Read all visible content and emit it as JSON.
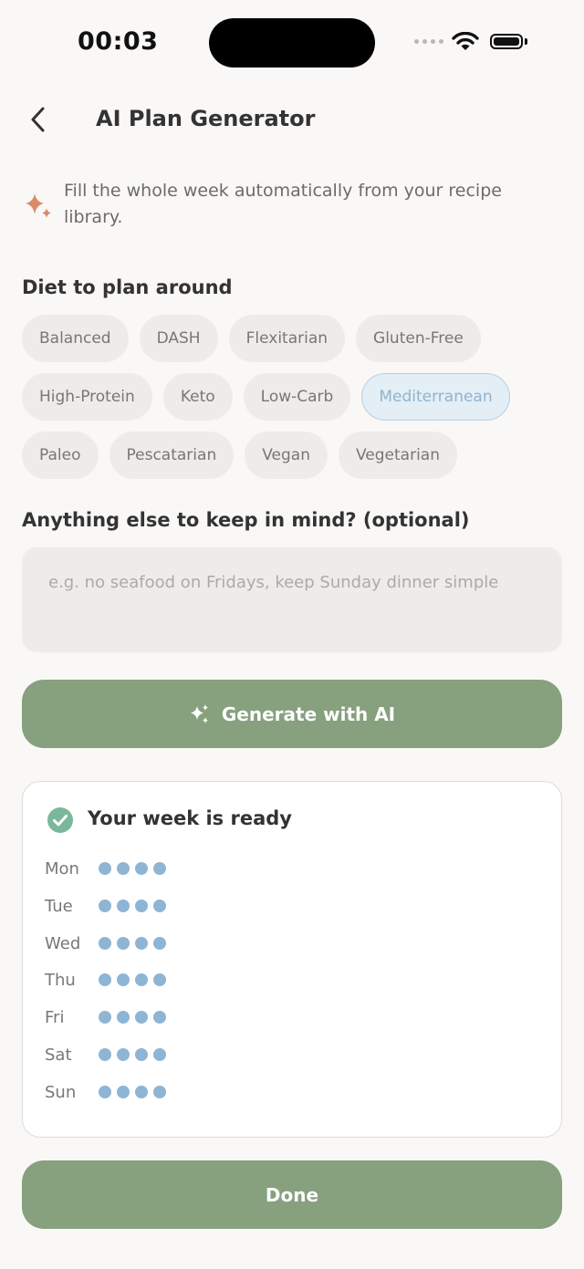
{
  "status_bar": {
    "time": "00:03"
  },
  "header": {
    "title": "AI Plan Generator",
    "back_icon": "chevron-left-icon"
  },
  "intro": {
    "icon": "sparkle-icon",
    "text": "Fill the whole week automatically from your recipe library.",
    "icon_color": "#d98a68"
  },
  "diet": {
    "label": "Diet to plan around",
    "selected": "Mediterranean",
    "rows": [
      [
        "Balanced",
        "DASH",
        "Flexitarian",
        "Gluten-Free"
      ],
      [
        "High-Protein",
        "Keto",
        "Low-Carb",
        "Mediterranean"
      ],
      [
        "Paleo",
        "Pescatarian",
        "Vegan",
        "Vegetarian"
      ]
    ]
  },
  "notes": {
    "label": "Anything else to keep in mind? (optional)",
    "placeholder": "e.g. no seafood on Fridays, keep Sunday dinner simple",
    "value": ""
  },
  "generate_button": {
    "label": "Generate with AI",
    "icon": "sparkles-icon"
  },
  "result": {
    "title": "Your week is ready",
    "icon": "check-circle-icon",
    "days": [
      {
        "label": "Mon",
        "meals": 4
      },
      {
        "label": "Tue",
        "meals": 4
      },
      {
        "label": "Wed",
        "meals": 4
      },
      {
        "label": "Thu",
        "meals": 4
      },
      {
        "label": "Fri",
        "meals": 4
      },
      {
        "label": "Sat",
        "meals": 4
      },
      {
        "label": "Sun",
        "meals": 4
      }
    ]
  },
  "done_button": {
    "label": "Done"
  },
  "colors": {
    "accent": "#87a07e",
    "selected_chip": "#e3eef5",
    "meal_dot": "#8fb5d5",
    "check": "#7bb89a"
  }
}
